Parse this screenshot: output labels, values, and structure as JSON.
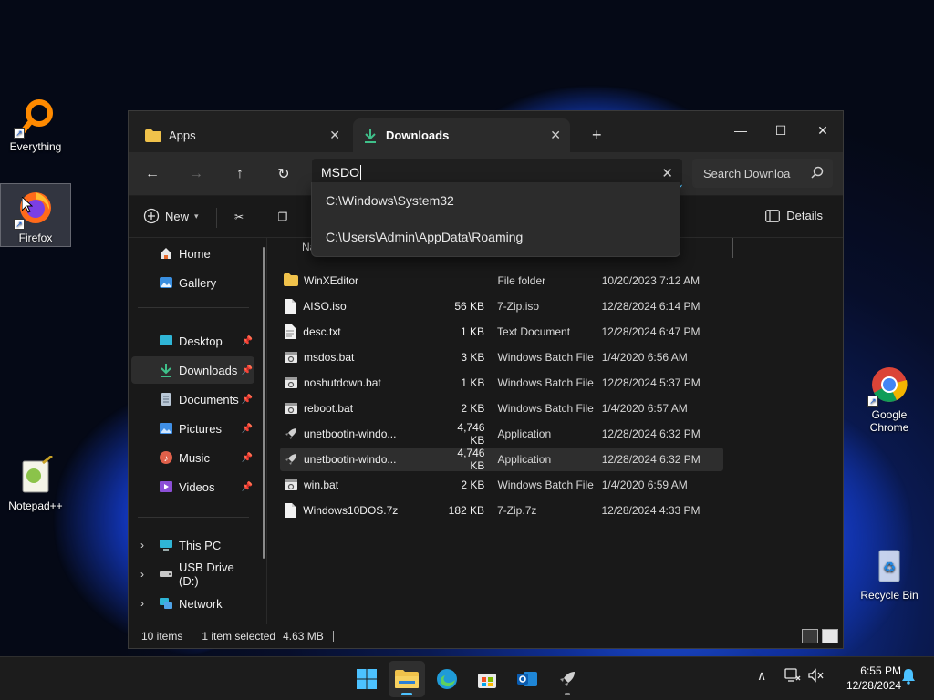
{
  "desktop": {
    "icons": [
      {
        "label": "Everything"
      },
      {
        "label": "Firefox"
      },
      {
        "label": "Notepad++"
      },
      {
        "label": "Google Chrome"
      },
      {
        "label": "Recycle Bin"
      }
    ]
  },
  "window": {
    "tabs": [
      {
        "label": "Apps",
        "icon": "folder-icon"
      },
      {
        "label": "Downloads",
        "icon": "download-icon"
      }
    ],
    "new_tab_label": "+",
    "address": {
      "value": "MSDO"
    },
    "search": {
      "placeholder": "Search Downloa"
    },
    "suggestions": [
      "C:\\Windows\\System32",
      "C:\\Users\\Admin\\AppData\\Roaming"
    ],
    "toolbar": {
      "new_label": "New",
      "details_label": "Details"
    },
    "sidebar": {
      "top": [
        {
          "label": "Home",
          "icon": "home-icon"
        },
        {
          "label": "Gallery",
          "icon": "gallery-icon"
        }
      ],
      "quick_access": [
        {
          "label": "Desktop",
          "icon": "desktop-icon"
        },
        {
          "label": "Downloads",
          "icon": "download-icon"
        },
        {
          "label": "Documents",
          "icon": "documents-icon"
        },
        {
          "label": "Pictures",
          "icon": "pictures-icon"
        },
        {
          "label": "Music",
          "icon": "music-icon"
        },
        {
          "label": "Videos",
          "icon": "videos-icon"
        }
      ],
      "drives": [
        {
          "label": "This PC",
          "icon": "computer-icon"
        },
        {
          "label": "USB Drive (D:)",
          "icon": "usb-drive-icon"
        },
        {
          "label": "Network",
          "icon": "network-icon"
        }
      ]
    },
    "column_header_partial": "Na",
    "files": [
      {
        "name": "WinXEditor",
        "size": "",
        "type": "File folder",
        "date": "10/20/2023 7:12 AM",
        "icon": "folder-icon"
      },
      {
        "name": "AISO.iso",
        "size": "56 KB",
        "type": "7-Zip.iso",
        "date": "12/28/2024 6:14 PM",
        "icon": "file-icon"
      },
      {
        "name": "desc.txt",
        "size": "1 KB",
        "type": "Text Document",
        "date": "12/28/2024 6:47 PM",
        "icon": "text-file-icon"
      },
      {
        "name": "msdos.bat",
        "size": "3 KB",
        "type": "Windows Batch File",
        "date": "1/4/2020 6:56 AM",
        "icon": "batch-file-icon"
      },
      {
        "name": "noshutdown.bat",
        "size": "1 KB",
        "type": "Windows Batch File",
        "date": "12/28/2024 5:37 PM",
        "icon": "batch-file-icon"
      },
      {
        "name": "reboot.bat",
        "size": "2 KB",
        "type": "Windows Batch File",
        "date": "1/4/2020 6:57 AM",
        "icon": "batch-file-icon"
      },
      {
        "name": "unetbootin-windo...",
        "size": "4,746 KB",
        "type": "Application",
        "date": "12/28/2024 6:32 PM",
        "icon": "application-icon"
      },
      {
        "name": "unetbootin-windo...",
        "size": "4,746 KB",
        "type": "Application",
        "date": "12/28/2024 6:32 PM",
        "icon": "application-icon"
      },
      {
        "name": "win.bat",
        "size": "2 KB",
        "type": "Windows Batch File",
        "date": "1/4/2020 6:59 AM",
        "icon": "batch-file-icon"
      },
      {
        "name": "Windows10DOS.7z",
        "size": "182 KB",
        "type": "7-Zip.7z",
        "date": "12/28/2024 4:33 PM",
        "icon": "file-icon"
      }
    ],
    "status": {
      "items": "10 items",
      "selected": "1 item selected",
      "size": "4.63 MB"
    }
  },
  "taskbar": {
    "clock_time": "6:55 PM",
    "clock_date": "12/28/2024"
  },
  "colors": {
    "accent": "#4cc2ff",
    "folder": "#f0c24b",
    "download_green": "#3fc08a"
  }
}
